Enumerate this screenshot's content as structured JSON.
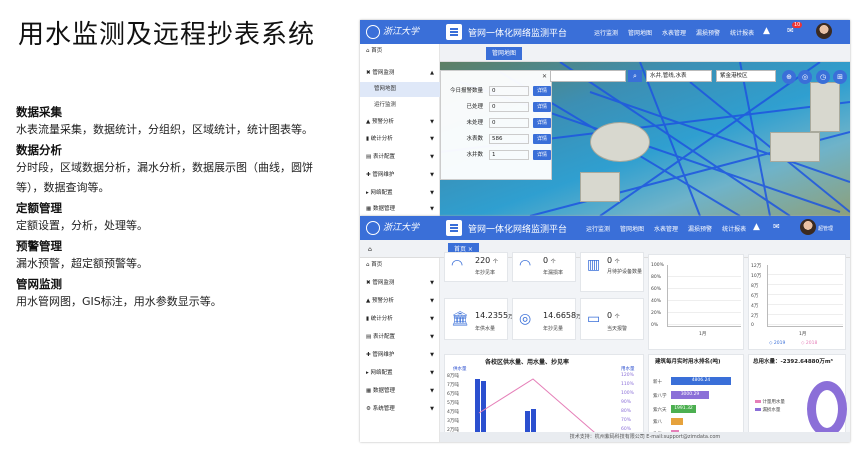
{
  "page_title": "用水监测及远程抄表系统",
  "features": [
    {
      "heading": "数据采集",
      "text": "水表流量采集，数据统计，分组织，区域统计，统计图表等。"
    },
    {
      "heading": "数据分析",
      "text": "分时段，区域数据分析，漏水分析，数据展示图（曲线，圆饼等），数据查询等。"
    },
    {
      "heading": "定额管理",
      "text": "定额设置，分析，处理等。"
    },
    {
      "heading": "预警管理",
      "text": "漏水预警，超定额预警等。"
    },
    {
      "heading": "管网监测",
      "text": "用水管网图，GIS标注，用水参数显示等。"
    }
  ],
  "app": {
    "logo_text": "浙江大学",
    "title": "管网一体化网络监测平台",
    "nav": [
      "运行监测",
      "管网地图",
      "水表管理",
      "漏损预警",
      "统计报表"
    ],
    "notification_count": "10",
    "user_name": "超管理"
  },
  "screen1": {
    "tabs": [
      "首页",
      "管网地图"
    ],
    "sidebar": [
      {
        "label": "首页",
        "icon": "home-icon"
      },
      {
        "label": "管网监测",
        "icon": "network-icon",
        "expanded": true
      },
      {
        "label": "管网地图",
        "sub": true,
        "selected": true
      },
      {
        "label": "运行监测",
        "sub": true
      },
      {
        "label": "预警分析",
        "icon": "warning-icon"
      },
      {
        "label": "统计分析",
        "icon": "chart-icon"
      },
      {
        "label": "表计配置",
        "icon": "meter-icon"
      },
      {
        "label": "管网维护",
        "icon": "wrench-icon"
      },
      {
        "label": "网络配置",
        "icon": "network-config-icon"
      },
      {
        "label": "数据管理",
        "icon": "data-icon"
      }
    ],
    "stats_panel": [
      {
        "label": "今日报警数量",
        "value": "0",
        "button": "详情"
      },
      {
        "label": "已处理",
        "value": "0",
        "button": "详情"
      },
      {
        "label": "未处理",
        "value": "0",
        "button": "详情"
      },
      {
        "label": "水表数",
        "value": "586",
        "button": "详情"
      },
      {
        "label": "水井数",
        "value": "1",
        "button": "详情"
      }
    ],
    "search_filter": "水井,管线,水表",
    "campus_select": "紫金港校区"
  },
  "screen2": {
    "tabs": [
      "首页"
    ],
    "sidebar": [
      {
        "label": "首页",
        "icon": "home-icon"
      },
      {
        "label": "管网监测",
        "icon": "network-icon"
      },
      {
        "label": "预警分析",
        "icon": "warning-icon"
      },
      {
        "label": "统计分析",
        "icon": "chart-icon"
      },
      {
        "label": "表计配置",
        "icon": "meter-icon"
      },
      {
        "label": "管网维护",
        "icon": "wrench-icon"
      },
      {
        "label": "网络配置",
        "icon": "network-config-icon"
      },
      {
        "label": "数据管理",
        "icon": "data-icon"
      },
      {
        "label": "系统管理",
        "icon": "gear-icon"
      }
    ],
    "kpis": [
      {
        "value": "220",
        "unit": "个",
        "label": "年抄见率"
      },
      {
        "value": "0",
        "unit": "个",
        "label": "年漏损率"
      },
      {
        "value": "0",
        "unit": "个",
        "label": "月待护设备数量"
      },
      {
        "value": "14.2355",
        "unit": "万m³",
        "label": "年供水量"
      },
      {
        "value": "14.6658",
        "unit": "万m³",
        "label": "年抄见量"
      },
      {
        "value": "0",
        "unit": "个",
        "label": "当天报警"
      }
    ],
    "chart1_title": "各校区供水量、用水量、抄见率",
    "chart1_legend": [
      "供水量",
      "用水量"
    ],
    "chart1_y_ticks": [
      "8万吨",
      "7万吨",
      "6万吨",
      "5万吨",
      "4万吨",
      "3万吨",
      "2万吨",
      "1万吨"
    ],
    "chart1_y2_ticks": [
      "120%",
      "110%",
      "100%",
      "90%",
      "80%",
      "70%",
      "60%",
      "50%"
    ],
    "chart2_title": "建筑每月实时用水排名(吨)",
    "chart2_names": [
      "新十",
      "紫八学",
      "紫六天",
      "紫八",
      "生化"
    ],
    "chart2_values": [
      "4806.24",
      "3000.29",
      "1991.32",
      "",
      ""
    ],
    "chart3_title": "总用水量：-2392.64880万m³",
    "chart3_legend": [
      "计量用水量",
      "漏损水量"
    ],
    "line_y_ticks": [
      "100%",
      "80%",
      "60%",
      "40%",
      "20%",
      "0%"
    ],
    "line_x_label": "1月",
    "line2_y_ticks": [
      "12万",
      "10万",
      "8万",
      "6万",
      "4万",
      "2万",
      "0"
    ],
    "line2_legend": [
      "2019",
      "2018"
    ],
    "footer": "技术支持：杭州紫码科技有限公司 E-mail:support@zimdata.com"
  },
  "colors": {
    "brand_blue": "#3a6fd8",
    "accent_purple": "#8b6fd8",
    "bar_blue": "#2b4fcf"
  }
}
